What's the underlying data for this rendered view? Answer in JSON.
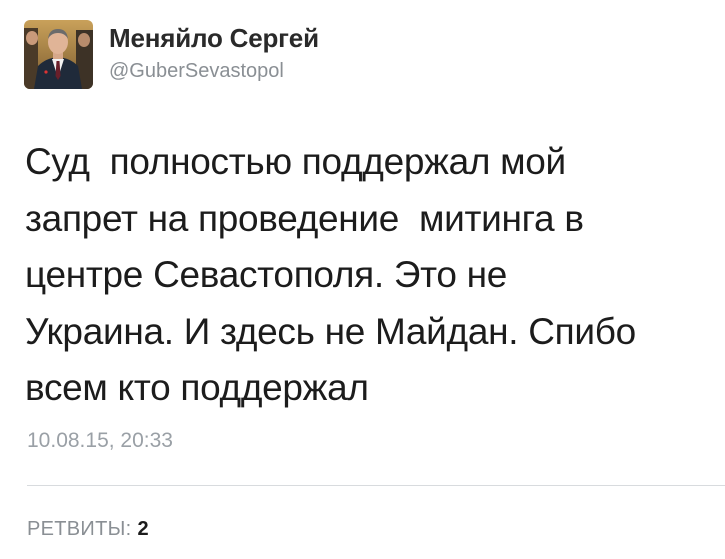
{
  "tweet": {
    "display_name": "Меняйло Сергей",
    "handle": "@GuberSevastopol",
    "text": "Суд  полностью поддержал мой\nзапрет на проведение  митинга в\nцентре Севастополя. Это не\nУкраина. И здесь не Майдан. Спибо\nвсем кто поддержал",
    "timestamp": "10.08.15, 20:33",
    "retweets_label": "РЕТВИТЫ:",
    "retweets_count": "2"
  },
  "colors": {
    "text_primary": "#1c1c1c",
    "text_secondary": "#8a8f94",
    "divider": "#d8dbde",
    "background": "#ffffff"
  },
  "icons": {
    "avatar": "user-avatar-photo"
  }
}
